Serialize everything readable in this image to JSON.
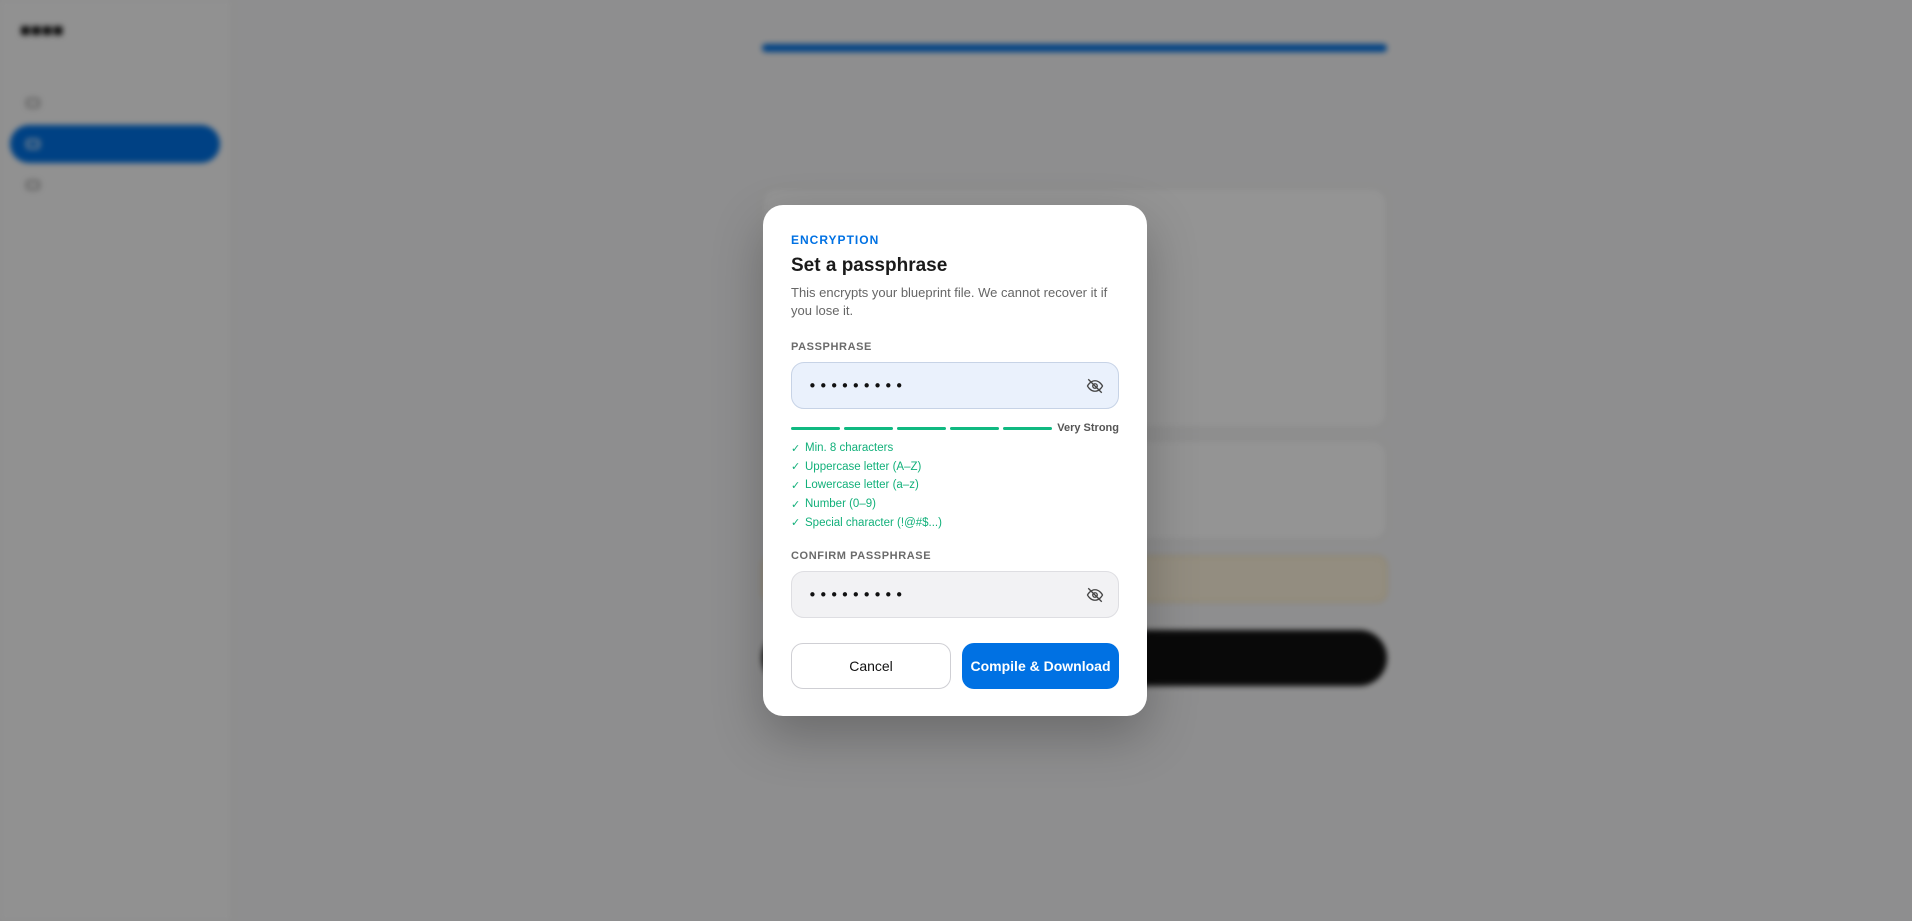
{
  "modal": {
    "eyebrow": "ENCRYPTION",
    "title": "Set a passphrase",
    "description": "This encrypts your blueprint file. We cannot recover it if you lose it.",
    "passphrase": {
      "label": "PASSPHRASE",
      "value": "•••••••••",
      "toggle_icon": "eye-off-icon"
    },
    "strength": {
      "label": "Very Strong",
      "filled_segments": 5,
      "total_segments": 5,
      "color": "#10b981"
    },
    "requirements": [
      {
        "label": "Min. 8 characters",
        "met": true
      },
      {
        "label": "Uppercase letter (A–Z)",
        "met": true
      },
      {
        "label": "Lowercase letter (a–z)",
        "met": true
      },
      {
        "label": "Number (0–9)",
        "met": true
      },
      {
        "label": "Special character (!@#$...)",
        "met": true
      }
    ],
    "check_glyph": "✓",
    "confirm": {
      "label": "CONFIRM PASSPHRASE",
      "value": "•••••••••",
      "toggle_icon": "eye-off-icon"
    },
    "buttons": {
      "cancel": "Cancel",
      "primary": "Compile & Download"
    }
  },
  "colors": {
    "accent": "#0071e3",
    "success": "#10b981",
    "overlay": "rgba(0,0,0,0.42)"
  }
}
